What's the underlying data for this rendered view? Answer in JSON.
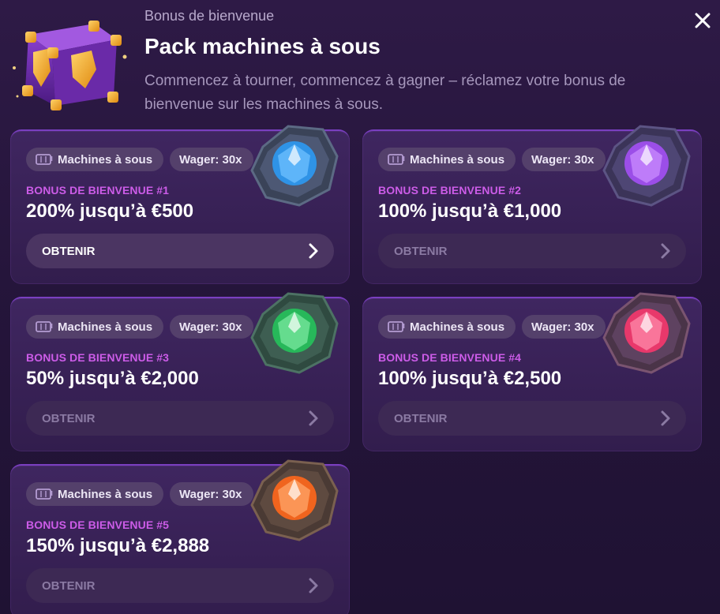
{
  "header": {
    "sup": "Bonus de bienvenue",
    "title": "Pack machines à sous",
    "description": "Commencez à tourner, commencez à gagner – réclamez votre bonus de bienvenue sur les machines à sous.",
    "close_icon": "close-icon",
    "chest_icon": "treasure-chest-icon"
  },
  "cards": [
    {
      "tag_game": "Machines à sous",
      "tag_wager": "Wager: 30x",
      "label": "BONUS DE BIENVENUE #1",
      "value": "200% jusqu’à €500",
      "button": "OBTENIR",
      "gem_color": "#2f93e6",
      "enabled": true
    },
    {
      "tag_game": "Machines à sous",
      "tag_wager": "Wager: 30x",
      "label": "BONUS DE BIENVENUE #2",
      "value": "100% jusqu’à €1,000",
      "button": "OBTENIR",
      "gem_color": "#9b4ee8",
      "enabled": false
    },
    {
      "tag_game": "Machines à sous",
      "tag_wager": "Wager: 30x",
      "label": "BONUS DE BIENVENUE #3",
      "value": "50% jusqu’à €2,000",
      "button": "OBTENIR",
      "gem_color": "#27b85a",
      "enabled": false
    },
    {
      "tag_game": "Machines à sous",
      "tag_wager": "Wager: 30x",
      "label": "BONUS DE BIENVENUE #4",
      "value": "100% jusqu’à €2,500",
      "button": "OBTENIR",
      "gem_color": "#e8386b",
      "enabled": false
    },
    {
      "tag_game": "Machines à sous",
      "tag_wager": "Wager: 30x",
      "label": "BONUS DE BIENVENUE #5",
      "value": "150% jusqu’à €2,888",
      "button": "OBTENIR",
      "gem_color": "#f0641e",
      "enabled": false
    }
  ],
  "colors": {
    "accent_label": "#cc5ce8",
    "card_border": "#7a3fc0",
    "background": "#25153b"
  },
  "icons": {
    "tag_game": "slot-machine-icon",
    "button": "chevron-right-icon",
    "gem": "gem-icon"
  }
}
